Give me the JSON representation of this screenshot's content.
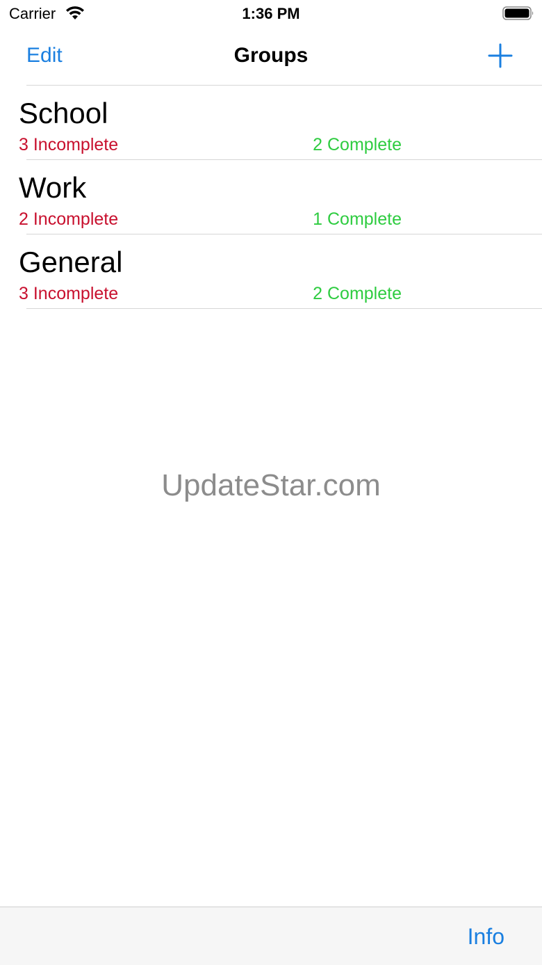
{
  "status_bar": {
    "carrier": "Carrier",
    "time": "1:36 PM",
    "wifi_icon": "wifi-icon",
    "battery_icon": "battery-icon"
  },
  "nav": {
    "edit_label": "Edit",
    "title": "Groups",
    "add_icon": "plus-icon"
  },
  "groups": [
    {
      "name": "School",
      "incomplete": "3 Incomplete",
      "complete": "2 Complete"
    },
    {
      "name": "Work",
      "incomplete": "2 Incomplete",
      "complete": "1 Complete"
    },
    {
      "name": "General",
      "incomplete": "3 Incomplete",
      "complete": "2 Complete"
    }
  ],
  "watermark": "UpdateStar.com",
  "toolbar": {
    "info_label": "Info"
  },
  "colors": {
    "accent": "#1a7fe0",
    "incomplete": "#c8102e",
    "complete": "#2ecc40"
  }
}
